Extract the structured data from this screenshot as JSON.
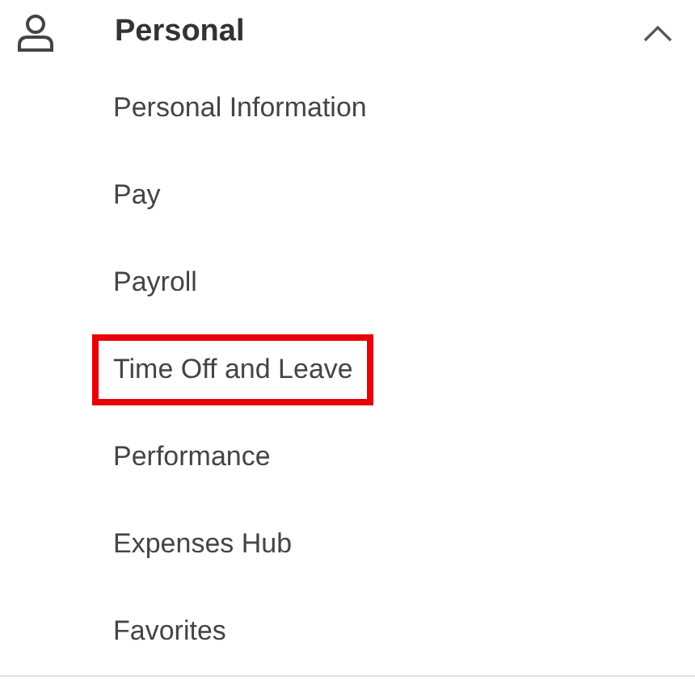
{
  "section": {
    "title": "Personal",
    "expanded": true
  },
  "items": [
    {
      "label": "Personal Information",
      "highlighted": false
    },
    {
      "label": "Pay",
      "highlighted": false
    },
    {
      "label": "Payroll",
      "highlighted": false
    },
    {
      "label": "Time Off and Leave",
      "highlighted": true
    },
    {
      "label": "Performance",
      "highlighted": false
    },
    {
      "label": "Expenses Hub",
      "highlighted": false
    },
    {
      "label": "Favorites",
      "highlighted": false
    }
  ]
}
